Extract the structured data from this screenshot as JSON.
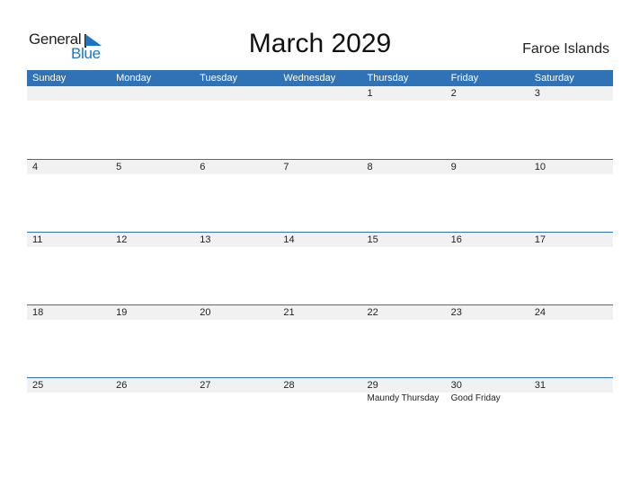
{
  "logo": {
    "word1": "General",
    "word2": "Blue"
  },
  "header": {
    "title": "March 2029",
    "country": "Faroe Islands"
  },
  "weekdays": [
    "Sunday",
    "Monday",
    "Tuesday",
    "Wednesday",
    "Thursday",
    "Friday",
    "Saturday"
  ],
  "weeks": [
    [
      {
        "day": ""
      },
      {
        "day": ""
      },
      {
        "day": ""
      },
      {
        "day": ""
      },
      {
        "day": "1"
      },
      {
        "day": "2"
      },
      {
        "day": "3"
      }
    ],
    [
      {
        "day": "4"
      },
      {
        "day": "5"
      },
      {
        "day": "6"
      },
      {
        "day": "7"
      },
      {
        "day": "8"
      },
      {
        "day": "9"
      },
      {
        "day": "10"
      }
    ],
    [
      {
        "day": "11"
      },
      {
        "day": "12"
      },
      {
        "day": "13"
      },
      {
        "day": "14"
      },
      {
        "day": "15"
      },
      {
        "day": "16"
      },
      {
        "day": "17"
      }
    ],
    [
      {
        "day": "18"
      },
      {
        "day": "19"
      },
      {
        "day": "20"
      },
      {
        "day": "21"
      },
      {
        "day": "22"
      },
      {
        "day": "23"
      },
      {
        "day": "24"
      }
    ],
    [
      {
        "day": "25"
      },
      {
        "day": "26"
      },
      {
        "day": "27"
      },
      {
        "day": "28"
      },
      {
        "day": "29",
        "event": "Maundy Thursday"
      },
      {
        "day": "30",
        "event": "Good Friday"
      },
      {
        "day": "31"
      }
    ]
  ],
  "colors": {
    "accent": "#2f72b6",
    "logo_blue": "#1a75c4",
    "date_strip": "#f1f1f1"
  }
}
